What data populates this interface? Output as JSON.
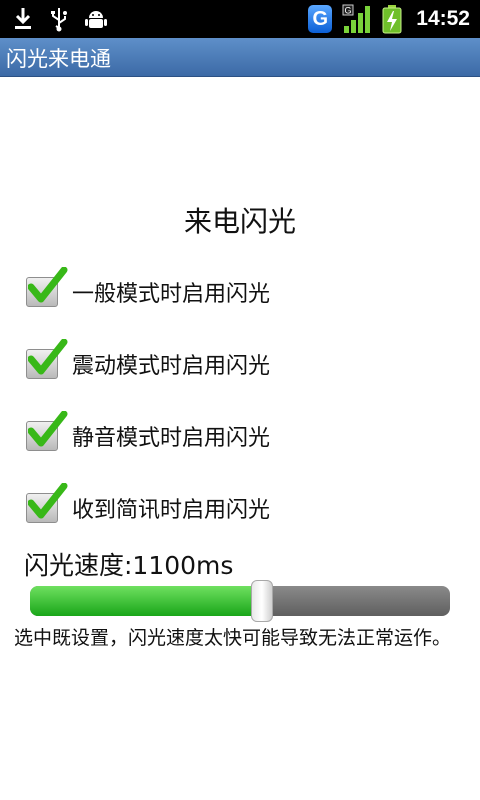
{
  "status_bar": {
    "left_icons": [
      "download-icon",
      "usb-icon",
      "android-debug-icon"
    ],
    "right_icons": [
      "g-app-icon",
      "signal-icon",
      "battery-charging-icon"
    ],
    "g_letter": "G",
    "time": "14:52"
  },
  "app": {
    "title": "闪光来电通"
  },
  "main": {
    "heading": "来电闪光",
    "options": [
      {
        "label": "一般模式时启用闪光",
        "checked": true
      },
      {
        "label": "震动模式时启用闪光",
        "checked": true
      },
      {
        "label": "静音模式时启用闪光",
        "checked": true
      },
      {
        "label": "收到简讯时启用闪光",
        "checked": true
      }
    ],
    "speed_label": "闪光速度:1100ms",
    "slider": {
      "value": 0.55
    },
    "note": "选中既设置，闪光速度太快可能导致无法正常运作。"
  },
  "colors": {
    "title_bar": "#4a7bb8",
    "slider_fill": "#2fb82a",
    "check_green": "#38b818"
  }
}
